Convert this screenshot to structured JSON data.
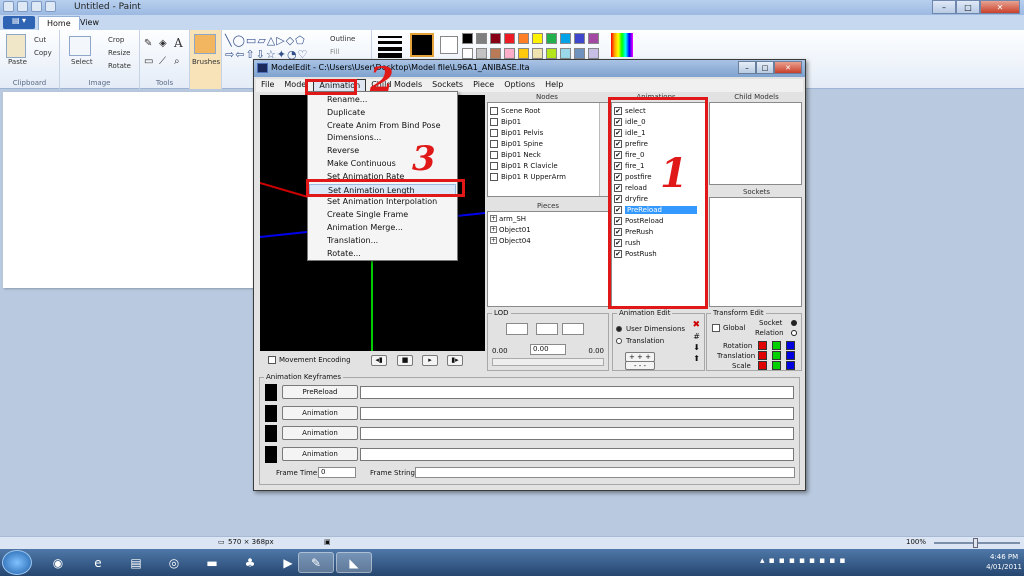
{
  "paint": {
    "title": "Untitled - Paint",
    "tabs": [
      "Home",
      "View"
    ],
    "clipboard": {
      "paste": "Paste",
      "cut": "Cut",
      "copy": "Copy",
      "label": "Clipboard"
    },
    "image": {
      "select": "Select",
      "crop": "Crop",
      "resize": "Resize",
      "rotate": "Rotate",
      "label": "Image"
    },
    "tools": {
      "label": "Tools",
      "text": "A"
    },
    "brushes": "Brushes",
    "shapes": {
      "outline": "Outline",
      "fill": "Fill"
    },
    "status": {
      "size": "570 × 368px",
      "zoom": "100%"
    }
  },
  "palette": [
    "#000000",
    "#7f7f7f",
    "#880015",
    "#ed1c24",
    "#ff7f27",
    "#fff200",
    "#22b14c",
    "#00a2e8",
    "#3f48cc",
    "#a349a4",
    "#ffffff",
    "#c3c3c3",
    "#b97a57",
    "#ffaec9",
    "#ffc90e",
    "#efe4b0",
    "#b5e61d",
    "#99d9ea",
    "#7092be",
    "#c8bfe7"
  ],
  "taskbar": {
    "time": "4:46 PM",
    "date": "4/01/2011"
  },
  "modeledit": {
    "title": "ModelEdit - C:\\Users\\User\\Desktop\\Model file\\L96A1_ANIBASE.ltа",
    "menu": [
      "File",
      "Model",
      "Animation",
      "Child Models",
      "Sockets",
      "Piece",
      "Options",
      "Help"
    ],
    "animation_menu": [
      "Rename...",
      "Duplicate",
      "Create Anim From Bind Pose",
      "Dimensions...",
      "Reverse",
      "Make Continuous",
      "Set Animation Rate",
      "Set Animation Length",
      "Set Animation Interpolation",
      "Create Single Frame",
      "Animation Merge...",
      "Translation...",
      "Rotate..."
    ],
    "nodes_header": "Nodes",
    "nodes": [
      "Scene Root",
      "Bip01",
      "Bip01 Pelvis",
      "Bip01 Spine",
      "Bip01 Neck",
      "Bip01 R Clavicle",
      "Bip01 R UpperArm"
    ],
    "pieces_header": "Pieces",
    "pieces": [
      "arm_SH",
      "Object01",
      "Object04"
    ],
    "animations_header": "Animations",
    "animations": [
      "select",
      "idle_0",
      "idle_1",
      "prefire",
      "fire_0",
      "fire_1",
      "postfire",
      "reload",
      "dryfire",
      "PreReload",
      "PostReload",
      "PreRush",
      "rush",
      "PostRush"
    ],
    "selected_animation": "PreReload",
    "child_models_header": "Child Models",
    "sockets_header": "Sockets",
    "movement_encoding": "Movement Encoding",
    "lod": {
      "label": "LOD",
      "left": "0.00",
      "mid": "0.00",
      "right": "0.00"
    },
    "anim_edit": {
      "label": "Animation Edit",
      "user_dimensions": "User Dimensions",
      "translation": "Translation"
    },
    "transform_edit": {
      "label": "Transform Edit",
      "global": "Global",
      "socket": "Socket",
      "relation": "Relation",
      "rotation": "Rotation",
      "translation": "Translation",
      "scale": "Scale"
    },
    "keyframes": {
      "label": "Animation Keyframes",
      "buttons": [
        "PreReload",
        "Animation",
        "Animation",
        "Animation"
      ],
      "frame_time_label": "Frame Time:",
      "frame_time": "0",
      "frame_string_label": "Frame String:"
    }
  },
  "annotations": [
    "1",
    "2",
    "3"
  ]
}
